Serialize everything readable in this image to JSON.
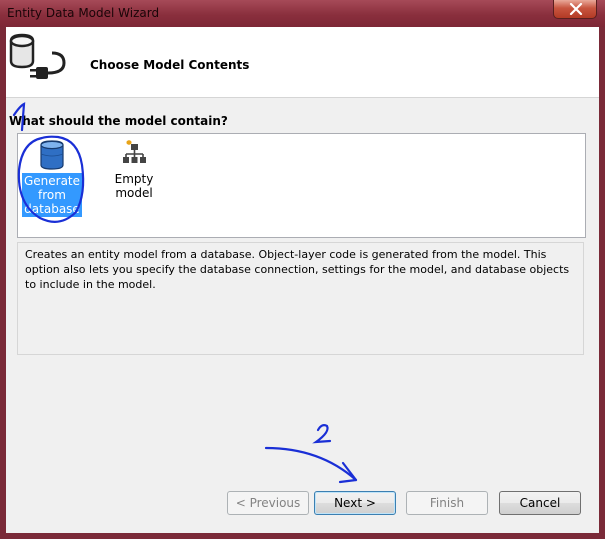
{
  "window": {
    "title": "Entity Data Model Wizard"
  },
  "header": {
    "title": "Choose Model Contents"
  },
  "question": "What should the model contain?",
  "options": [
    {
      "label_lines": [
        "Generate",
        "from",
        "database"
      ],
      "selected": true,
      "icon": "database-icon"
    },
    {
      "label_lines": [
        "Empty model"
      ],
      "selected": false,
      "icon": "hierarchy-icon"
    }
  ],
  "description": "Creates an entity model from a database. Object-layer code is generated from the model. This option also lets you specify the database connection, settings for the model, and database objects to include in the model.",
  "buttons": {
    "previous": "< Previous",
    "next": "Next >",
    "finish": "Finish",
    "cancel": "Cancel"
  },
  "annotations": {
    "step1": "1",
    "step2": "2"
  },
  "colors": {
    "selection": "#3399ff",
    "annotation_ink": "#1a2fd6",
    "titlebar": "#8a2f3d"
  }
}
